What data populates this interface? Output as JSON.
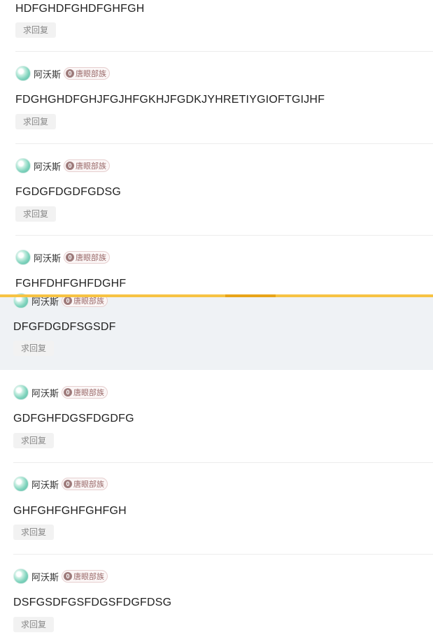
{
  "reply_label": "求回复",
  "user": {
    "name": "阿沃斯",
    "level": "0",
    "badge": "唐眼部族"
  },
  "upper_posts": [
    {
      "text": "HDFGHDFGHDFGHFGH"
    },
    {
      "text": "FDGHGHDFGHJFGJHFGKHJFGDKJYHRETIYGIOFTGIJHF"
    },
    {
      "text": "FGDGFDGDFGDSG"
    },
    {
      "text": "FGHFDHFGHFDGHF"
    }
  ],
  "lower_posts": [
    {
      "text": "DFGFDGDFSGSDF"
    },
    {
      "text": "GDFGHFDGSFDGDFG"
    },
    {
      "text": "GHFGHFGHFGHFGH"
    },
    {
      "text": "DSFGSDFGSFDGSFDGFDSG"
    }
  ],
  "colors": {
    "highlight": "#eff2f5",
    "progress": "#f7c343",
    "progress_active": "#e8a419"
  }
}
